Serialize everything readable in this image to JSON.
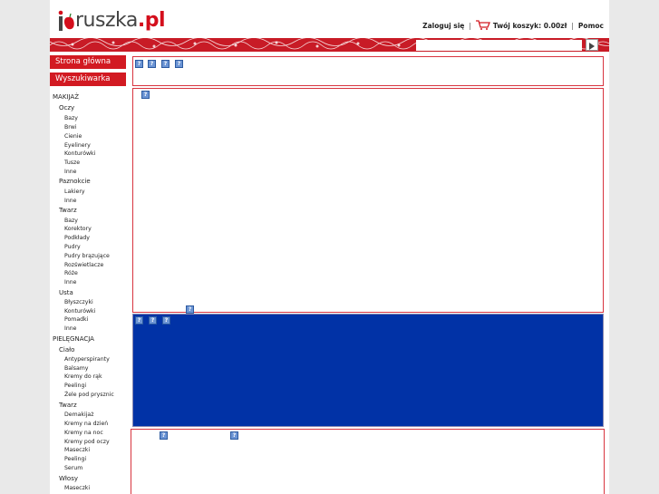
{
  "logo": {
    "text_main": "ruszka",
    "text_suffix": ".pl"
  },
  "topnav": {
    "login": "Zaloguj się",
    "sep": "|",
    "cart_label": "Twój koszyk: 0.00zł",
    "help": "Pomoc"
  },
  "search": {
    "placeholder": ""
  },
  "buttons": {
    "home": "Strona główna",
    "search_page": "Wyszukiwarka"
  },
  "sidebar": {
    "makijaz": "MAKIJAŻ",
    "oczy": "Oczy",
    "oczy_items": [
      "Bazy",
      "Brwi",
      "Cienie",
      "Eyelinery",
      "Konturówki",
      "Tusze",
      "Inne"
    ],
    "paznokcie": "Paznokcie",
    "paznokcie_items": [
      "Lakiery",
      "Inne"
    ],
    "twarz": "Twarz",
    "twarz_items": [
      "Bazy",
      "Korektory",
      "Podkłady",
      "Pudry",
      "Pudry brązujące",
      "Rozświetlacze",
      "Róże",
      "Inne"
    ],
    "usta": "Usta",
    "usta_items": [
      "Błyszczyki",
      "Konturówki",
      "Pomadki",
      "Inne"
    ],
    "pielegnacja": "PIELĘGNACJA",
    "cialo": "Ciało",
    "cialo_items": [
      "Antyperspiranty",
      "Balsamy",
      "Kremy do rąk",
      "Peelingi",
      "Żele pod prysznic"
    ],
    "twarz2": "Twarz",
    "twarz2_items": [
      "Demakijaż",
      "Kremy na dzień",
      "Kremy na noc",
      "Kremy pod oczy",
      "Maseczki",
      "Peelingi",
      "Serum"
    ],
    "wlosy": "Włosy",
    "wlosy_items": [
      "Maseczki"
    ]
  },
  "placeholder_glyph": "?",
  "colors": {
    "brand_red": "#d21a22",
    "blue_panel": "#0132a6",
    "box_border": "#d8343f"
  }
}
